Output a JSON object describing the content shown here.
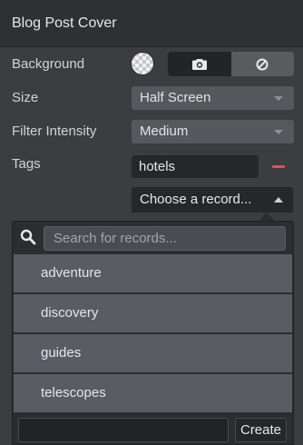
{
  "header": {
    "title": "Blog Post Cover"
  },
  "fields": {
    "background": {
      "label": "Background",
      "icons": [
        "camera-icon",
        "ban-icon"
      ]
    },
    "size": {
      "label": "Size",
      "value": "Half Screen"
    },
    "filter_intensity": {
      "label": "Filter Intensity",
      "value": "Medium"
    },
    "tags": {
      "label": "Tags",
      "values": [
        "hotels"
      ],
      "picker_placeholder": "Choose a record..."
    }
  },
  "dropdown": {
    "search_placeholder": "Search for records...",
    "items": [
      "adventure",
      "discovery",
      "guides",
      "telescopes"
    ],
    "create_label": "Create"
  },
  "colors": {
    "remove": "#d9535b",
    "panel": "#3c3d41"
  }
}
